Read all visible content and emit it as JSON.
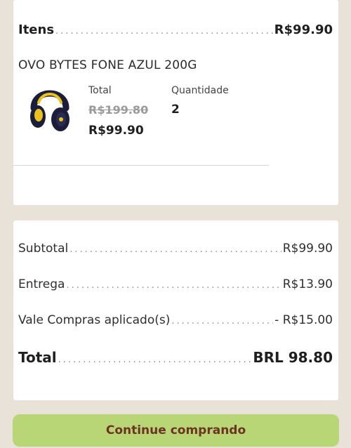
{
  "items_card": {
    "itens_label": "Itens",
    "itens_value": "R$99.90",
    "product": {
      "name": "OVO BYTES FONE AZUL 200G",
      "image_icon": "headphones-icon",
      "total_label": "Total",
      "original_price": "R$199.80",
      "current_price": "R$99.90",
      "quantity_label": "Quantidade",
      "quantity_value": "2"
    }
  },
  "summary": {
    "subtotal_label": "Subtotal",
    "subtotal_value": "R$99.90",
    "entrega_label": "Entrega",
    "entrega_value": "R$13.90",
    "vale_label": "Vale Compras aplicado(s)",
    "vale_value": "- R$15.00",
    "total_label": "Total",
    "total_value": "BRL 98.80"
  },
  "continue_button_label": "Continue comprando",
  "colors": {
    "background": "#e8e2d8",
    "card": "#ffffff",
    "button": "#b9d676",
    "button_text": "#6b3322"
  }
}
